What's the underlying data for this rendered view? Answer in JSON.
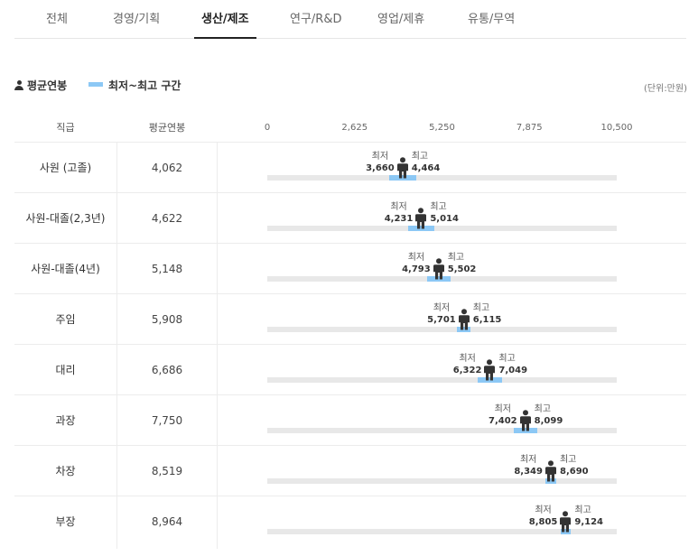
{
  "tabs": [
    {
      "label": "전체",
      "active": false
    },
    {
      "label": "경영/기획",
      "active": false
    },
    {
      "label": "생산/제조",
      "active": true
    },
    {
      "label": "연구/R&D",
      "active": false
    },
    {
      "label": "영업/제휴",
      "active": false
    },
    {
      "label": "유통/무역",
      "active": false
    }
  ],
  "legend": {
    "avg_label": "평균연봉",
    "range_label": "최저~최고 구간",
    "avg_icon": "person-icon",
    "range_color": "#8cc8f5"
  },
  "unit": "(단위:만원)",
  "table": {
    "grade_header": "직급",
    "avg_header": "평균연봉"
  },
  "range_labels": {
    "min": "최저",
    "max": "최고"
  },
  "chart_data": {
    "type": "bar",
    "orientation": "horizontal-range",
    "xlim": [
      0,
      10500
    ],
    "ticks": [
      "0",
      "2,625",
      "5,250",
      "7,875",
      "10,500"
    ],
    "tick_values": [
      0,
      2625,
      5250,
      7875,
      10500
    ],
    "grid": false,
    "legend_position": "top-left",
    "rows": [
      {
        "grade": "사원 (고졸)",
        "avg": 4062,
        "avg_text": "4,062",
        "min": 3660,
        "min_text": "3,660",
        "max": 4464,
        "max_text": "4,464"
      },
      {
        "grade": "사원-대졸(2,3년)",
        "avg": 4622,
        "avg_text": "4,622",
        "min": 4231,
        "min_text": "4,231",
        "max": 5014,
        "max_text": "5,014"
      },
      {
        "grade": "사원-대졸(4년)",
        "avg": 5148,
        "avg_text": "5,148",
        "min": 4793,
        "min_text": "4,793",
        "max": 5502,
        "max_text": "5,502"
      },
      {
        "grade": "주임",
        "avg": 5908,
        "avg_text": "5,908",
        "min": 5701,
        "min_text": "5,701",
        "max": 6115,
        "max_text": "6,115"
      },
      {
        "grade": "대리",
        "avg": 6686,
        "avg_text": "6,686",
        "min": 6322,
        "min_text": "6,322",
        "max": 7049,
        "max_text": "7,049"
      },
      {
        "grade": "과장",
        "avg": 7750,
        "avg_text": "7,750",
        "min": 7402,
        "min_text": "7,402",
        "max": 8099,
        "max_text": "8,099"
      },
      {
        "grade": "차장",
        "avg": 8519,
        "avg_text": "8,519",
        "min": 8349,
        "min_text": "8,349",
        "max": 8690,
        "max_text": "8,690"
      },
      {
        "grade": "부장",
        "avg": 8964,
        "avg_text": "8,964",
        "min": 8805,
        "min_text": "8,805",
        "max": 9124,
        "max_text": "9,124"
      }
    ]
  }
}
